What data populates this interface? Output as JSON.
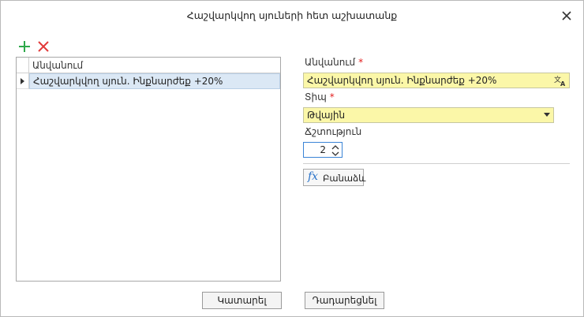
{
  "dialog": {
    "title": "Հաշվարկվող սյուների հետ աշխատանք"
  },
  "toolbar": {
    "icons": [
      "add-icon",
      "delete-icon"
    ],
    "add_color": "#2ea84a",
    "delete_color": "#e23a3a"
  },
  "grid": {
    "column_header": "Անվանում",
    "rows": [
      {
        "name": "Հաշվարկվող սյուն. Ինքնարժեք +20%"
      }
    ]
  },
  "form": {
    "name_label": "Անվանում",
    "name_required": "*",
    "name_value": "Հաշվարկվող սյուն. Ինքնարժեք +20%",
    "type_label": "Տիպ",
    "type_required": "*",
    "type_value": "Թվային",
    "precision_label": "Ճշտություն",
    "precision_value": "2",
    "formula_icon_text": "fx",
    "formula_button": "Բանաձև"
  },
  "footer": {
    "ok_label": "Կատարել",
    "cancel_label": "Դադարեցնել"
  },
  "colors": {
    "required_field_bg": "#fbf7a8",
    "selected_row_bg": "#dbe8f5",
    "accent": "#2a73c9",
    "required_mark": "#e21c1c"
  }
}
